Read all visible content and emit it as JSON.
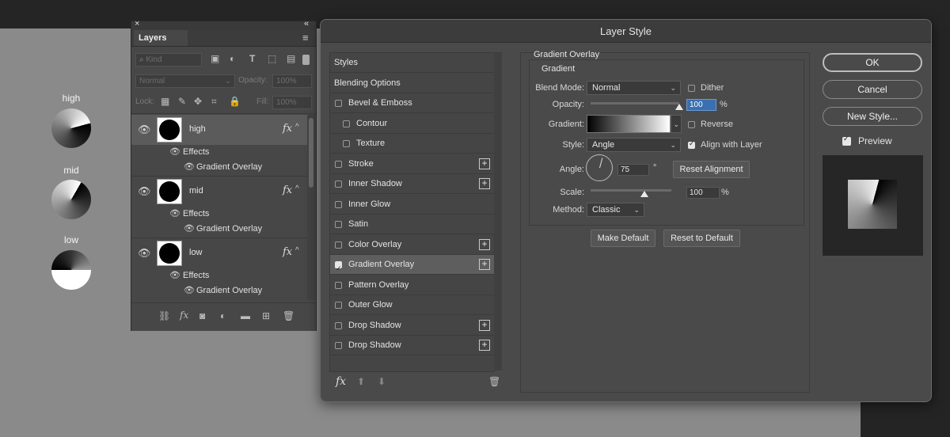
{
  "canvas": {
    "disks": [
      {
        "label": "high",
        "gradient": "conic-gradient(from 75deg, #000 0deg, #1a1a1a 60deg, #777 200deg, #fff 359.9deg)"
      },
      {
        "label": "mid",
        "gradient": "conic-gradient(from 30deg, #000 0deg, #333 80deg, #888 200deg, #fff 359.9deg)"
      },
      {
        "label": "low",
        "gradient": "conic-gradient(from 270deg, #000 0deg, #333 90deg, #999 180deg, #fff 179.9deg, #fff 359.9deg)"
      }
    ]
  },
  "layers_panel": {
    "close_glyph": "×",
    "collapse_glyph": "«",
    "tab_label": "Layers",
    "menu_glyph": "≡",
    "filter_placeholder": "Kind",
    "blend_mode": "Normal",
    "opacity_label": "Opacity:",
    "opacity_value": "100%",
    "lock_label": "Lock:",
    "fill_label": "Fill:",
    "fill_value": "100%",
    "layers": [
      {
        "name": "high",
        "effects_label": "Effects",
        "effect": "Gradient Overlay",
        "selected": true
      },
      {
        "name": "mid",
        "effects_label": "Effects",
        "effect": "Gradient Overlay",
        "selected": false
      },
      {
        "name": "low",
        "effects_label": "Effects",
        "effect": "Gradient Overlay",
        "selected": false
      }
    ],
    "fx_glyph": "fx",
    "caret_glyph": "^",
    "eye_glyph": "👁"
  },
  "dialog": {
    "title": "Layer Style",
    "styles": [
      {
        "label": "Styles",
        "checkbox": false,
        "plus": false,
        "indent": 0,
        "selected": false
      },
      {
        "label": "Blending Options",
        "checkbox": false,
        "plus": false,
        "indent": 0,
        "selected": false
      },
      {
        "label": "Bevel & Emboss",
        "checkbox": true,
        "checked": false,
        "plus": false,
        "indent": 0,
        "selected": false
      },
      {
        "label": "Contour",
        "checkbox": true,
        "checked": false,
        "plus": false,
        "indent": 1,
        "selected": false
      },
      {
        "label": "Texture",
        "checkbox": true,
        "checked": false,
        "plus": false,
        "indent": 1,
        "selected": false
      },
      {
        "label": "Stroke",
        "checkbox": true,
        "checked": false,
        "plus": true,
        "indent": 0,
        "selected": false
      },
      {
        "label": "Inner Shadow",
        "checkbox": true,
        "checked": false,
        "plus": true,
        "indent": 0,
        "selected": false
      },
      {
        "label": "Inner Glow",
        "checkbox": true,
        "checked": false,
        "plus": false,
        "indent": 0,
        "selected": false
      },
      {
        "label": "Satin",
        "checkbox": true,
        "checked": false,
        "plus": false,
        "indent": 0,
        "selected": false
      },
      {
        "label": "Color Overlay",
        "checkbox": true,
        "checked": false,
        "plus": true,
        "indent": 0,
        "selected": false
      },
      {
        "label": "Gradient Overlay",
        "checkbox": true,
        "checked": true,
        "plus": true,
        "indent": 0,
        "selected": true
      },
      {
        "label": "Pattern Overlay",
        "checkbox": true,
        "checked": false,
        "plus": false,
        "indent": 0,
        "selected": false
      },
      {
        "label": "Outer Glow",
        "checkbox": true,
        "checked": false,
        "plus": false,
        "indent": 0,
        "selected": false
      },
      {
        "label": "Drop Shadow",
        "checkbox": true,
        "checked": false,
        "plus": true,
        "indent": 0,
        "selected": false
      },
      {
        "label": "Drop Shadow",
        "checkbox": true,
        "checked": false,
        "plus": true,
        "indent": 0,
        "selected": false
      }
    ],
    "list_footer": {
      "fx": "fx",
      "up": "⬆",
      "down": "⬇",
      "trash": "🗑"
    },
    "settings": {
      "section_title": "Gradient Overlay",
      "group_title": "Gradient",
      "blend_mode_label": "Blend Mode:",
      "blend_mode_value": "Normal",
      "dither_label": "Dither",
      "dither_checked": false,
      "opacity_label": "Opacity:",
      "opacity_value": "100",
      "opacity_percent": 100,
      "percent_sign": "%",
      "gradient_label": "Gradient:",
      "reverse_label": "Reverse",
      "reverse_checked": false,
      "style_label": "Style:",
      "style_value": "Angle",
      "align_label": "Align with Layer",
      "align_checked": true,
      "angle_label": "Angle:",
      "angle_value": "75",
      "degree_sign": "°",
      "reset_alignment_label": "Reset Alignment",
      "scale_label": "Scale:",
      "scale_value": "100",
      "scale_percent": 100,
      "method_label": "Method:",
      "method_value": "Classic",
      "make_default_label": "Make Default",
      "reset_default_label": "Reset to Default"
    },
    "buttons": {
      "ok": "OK",
      "cancel": "Cancel",
      "new_style": "New Style..."
    },
    "preview_label": "Preview",
    "preview_checked": true
  }
}
